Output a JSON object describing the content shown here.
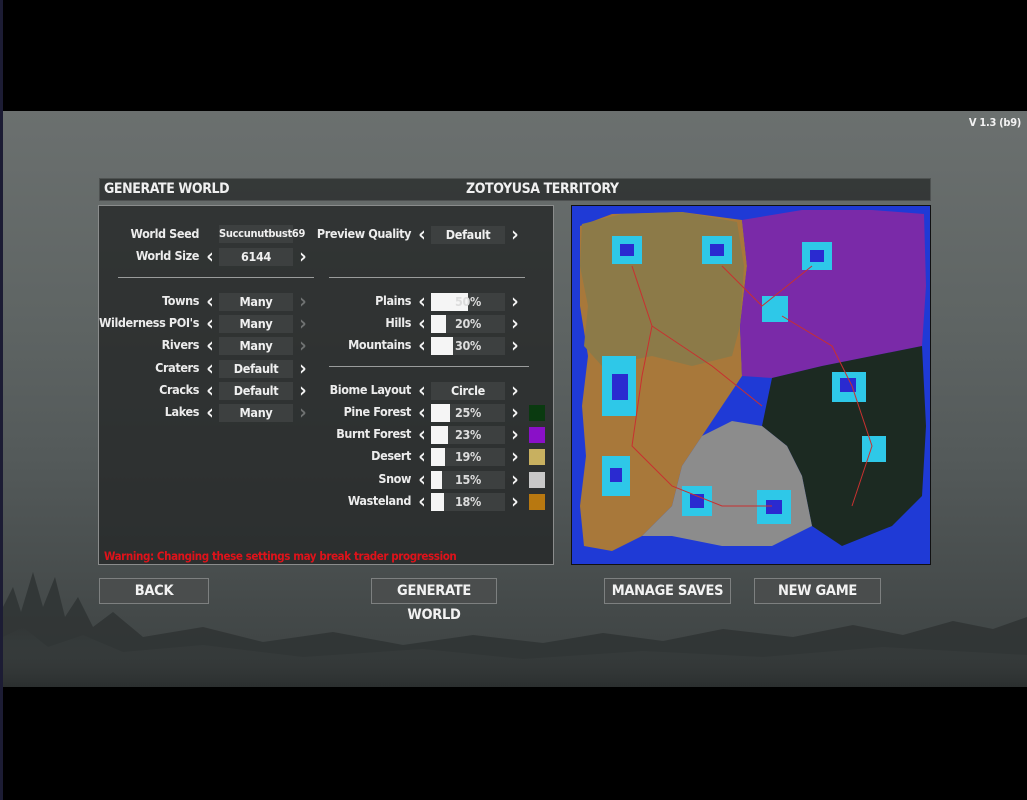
{
  "version": "V 1.3 (b9)",
  "header": {
    "generate_world": "GENERATE WORLD",
    "territory": "ZOTOYUSA TERRITORY"
  },
  "left": {
    "world_seed": {
      "label": "World Seed",
      "value": "Succunutbust69"
    },
    "world_size": {
      "label": "World Size",
      "value": "6144"
    },
    "towns": {
      "label": "Towns",
      "value": "Many"
    },
    "wilderness": {
      "label": "Wilderness POI's",
      "value": "Many"
    },
    "rivers": {
      "label": "Rivers",
      "value": "Many"
    },
    "craters": {
      "label": "Craters",
      "value": "Default"
    },
    "cracks": {
      "label": "Cracks",
      "value": "Default"
    },
    "lakes": {
      "label": "Lakes",
      "value": "Many"
    }
  },
  "right": {
    "preview_quality": {
      "label": "Preview Quality",
      "value": "Default"
    },
    "plains": {
      "label": "Plains",
      "value": "50%",
      "fraction": 0.5
    },
    "hills": {
      "label": "Hills",
      "value": "20%",
      "fraction": 0.2
    },
    "mountains": {
      "label": "Mountains",
      "value": "30%",
      "fraction": 0.3
    },
    "biome_layout": {
      "label": "Biome Layout",
      "value": "Circle"
    },
    "pine_forest": {
      "label": "Pine Forest",
      "value": "25%",
      "fraction": 0.25,
      "color": "#0a3a10"
    },
    "burnt_forest": {
      "label": "Burnt Forest",
      "value": "23%",
      "fraction": 0.23,
      "color": "#8a10c8"
    },
    "desert": {
      "label": "Desert",
      "value": "19%",
      "fraction": 0.19,
      "color": "#c8b060"
    },
    "snow": {
      "label": "Snow",
      "value": "15%",
      "fraction": 0.15,
      "color": "#c8c8c8"
    },
    "wasteland": {
      "label": "Wasteland",
      "value": "18%",
      "fraction": 0.18,
      "color": "#b87810"
    }
  },
  "warning": "Warning: Changing these settings may break trader progression",
  "buttons": {
    "back": "BACK",
    "generate": "GENERATE WORLD",
    "manage_saves": "MANAGE SAVES",
    "new_game": "NEW GAME"
  },
  "icons": {
    "prev": "chevron-left-icon",
    "next": "chevron-right-icon"
  }
}
